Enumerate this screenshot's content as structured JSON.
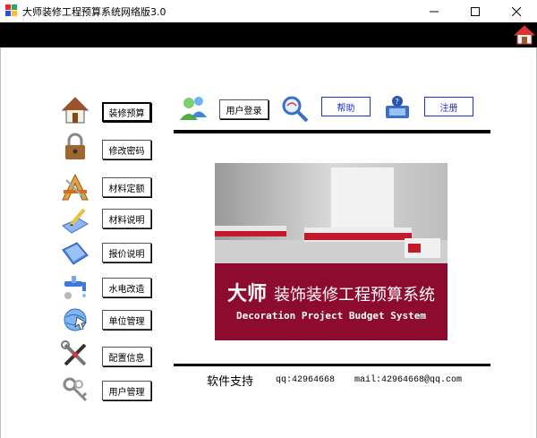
{
  "window": {
    "title": "大师装修工程预算系统网络版3.0"
  },
  "sidebar": {
    "items": [
      {
        "label": "装修预算",
        "icon": "house-icon"
      },
      {
        "label": "修改密码",
        "icon": "padlock-icon"
      },
      {
        "label": "材料定额",
        "icon": "drafting-tools-icon"
      },
      {
        "label": "材料说明",
        "icon": "pencil-paper-icon"
      },
      {
        "label": "报价说明",
        "icon": "document-icon"
      },
      {
        "label": "水电改造",
        "icon": "faucet-icon"
      },
      {
        "label": "单位管理",
        "icon": "globe-cursor-icon"
      },
      {
        "label": "配置信息",
        "icon": "tools-icon"
      },
      {
        "label": "用户管理",
        "icon": "keys-icon"
      }
    ]
  },
  "toolbar": {
    "login_label": "用户登录",
    "help_label": "帮助",
    "register_label": "注册"
  },
  "banner": {
    "title_brand": "大师",
    "title_rest": "装饰装修工程预算系统",
    "subtitle": "Decoration Project Budget System"
  },
  "footer": {
    "support_label": "软件支持",
    "qq": "qq:42964668",
    "mail": "mail:42964668@qq.com"
  },
  "colors": {
    "banner_red": "#8c0b2e",
    "link_blue": "#1f2fd8"
  }
}
